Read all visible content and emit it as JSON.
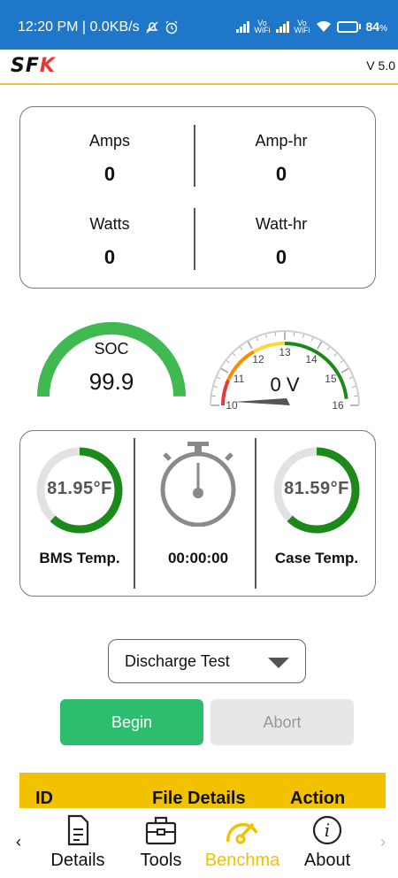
{
  "status_bar": {
    "time_info": "12:20 PM | 0.0KB/s",
    "network_tag": "Vo\nWiFi",
    "battery_text": "84",
    "battery_unit": "%",
    "battery_level": 0.84
  },
  "header": {
    "version": "V 5.0"
  },
  "stats": {
    "amps_label": "Amps",
    "amps_value": "0",
    "amp_hr_label": "Amp-hr",
    "amp_hr_value": "0",
    "watts_label": "Watts",
    "watts_value": "0",
    "watt_hr_label": "Watt-hr",
    "watt_hr_value": "0"
  },
  "soc_gauge": {
    "label": "SOC",
    "value": "99.9",
    "fraction": 0.999,
    "color": "#3fb950"
  },
  "voltage_gauge": {
    "value_text": "0 V",
    "value": 0,
    "min": 10,
    "max": 16,
    "ticks": [
      "10",
      "11",
      "12",
      "13",
      "14",
      "15",
      "16"
    ]
  },
  "temps": {
    "bms": {
      "value": "81.95°F",
      "label": "BMS Temp.",
      "fraction": 0.62
    },
    "timer": {
      "value": "00:00:00"
    },
    "case": {
      "value": "81.59°F",
      "label": "Case Temp.",
      "fraction": 0.62
    }
  },
  "test_select": {
    "value": "Discharge Test"
  },
  "buttons": {
    "begin": "Begin",
    "abort": "Abort"
  },
  "table": {
    "col_id": "ID",
    "col_file": "File Details",
    "col_action": "Action"
  },
  "nav": {
    "items": [
      {
        "label": "Details",
        "icon": "document-icon"
      },
      {
        "label": "Tools",
        "icon": "toolbox-icon"
      },
      {
        "label": "Benchma",
        "icon": "speedometer-icon",
        "active": true
      },
      {
        "label": "About",
        "icon": "info-icon"
      }
    ],
    "active_color": "#f2c100"
  }
}
